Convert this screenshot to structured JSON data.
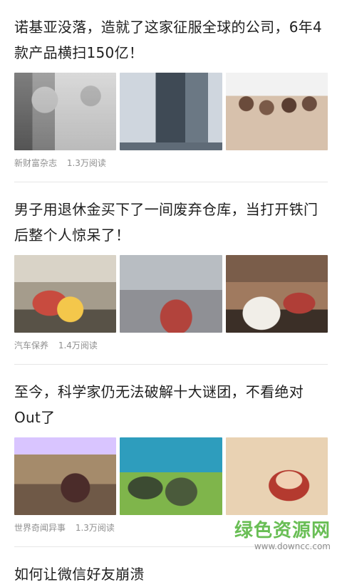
{
  "feed": {
    "articles": [
      {
        "title": "诺基亚没落，造就了这家征服全球的公司，6年4款产品横扫150亿！",
        "source": "新财富杂志",
        "reads": "1.3万阅读",
        "images": [
          "office-photo",
          "building-photo",
          "crowd-photo"
        ]
      },
      {
        "title": "男子用退休金买下了一间废弃仓库，当打开铁门后整个人惊呆了！",
        "source": "汽车保养",
        "reads": "1.4万阅读",
        "images": [
          "garage-cars-photo",
          "dusty-cars-photo",
          "classic-cars-photo"
        ]
      },
      {
        "title": "至今，科学家仍无法破解十大谜团，不看绝对Out了",
        "source": "世界奇闻异事",
        "reads": "1.3万阅读",
        "images": [
          "ancient-city-photo",
          "underwater-statue-photo",
          "explorer-portrait-photo"
        ]
      },
      {
        "title": "如何让微信好友崩溃"
      }
    ]
  },
  "watermark": {
    "text_cn": "绿色资源网",
    "text_en": "www.downcc.com"
  }
}
